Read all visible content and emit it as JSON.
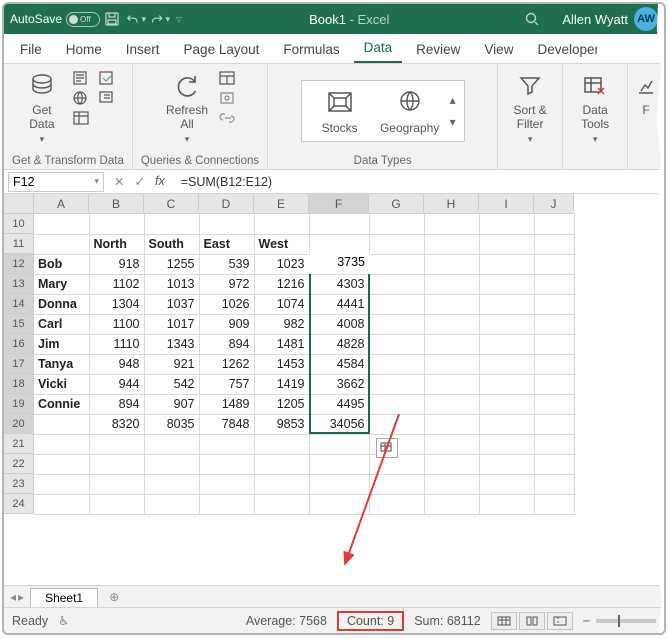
{
  "titlebar": {
    "autosave_label": "AutoSave",
    "autosave_state": "Off",
    "doc": "Book1",
    "app": "Excel",
    "user": "Allen Wyatt",
    "initials": "AW"
  },
  "tabs": [
    "File",
    "Home",
    "Insert",
    "Page Layout",
    "Formulas",
    "Data",
    "Review",
    "View",
    "Developer"
  ],
  "active_tab": "Data",
  "ribbon": {
    "group1_label": "Get & Transform Data",
    "get_data": "Get\nData",
    "group2_label": "Queries & Connections",
    "refresh_all": "Refresh\nAll",
    "group3_label": "Data Types",
    "stocks": "Stocks",
    "geography": "Geography",
    "sort_filter": "Sort &\nFilter",
    "data_tools": "Data\nTools",
    "forecast_initial": "F"
  },
  "namebox": "F12",
  "formula": "=SUM(B12:E12)",
  "columns": [
    "A",
    "B",
    "C",
    "D",
    "E",
    "F",
    "G",
    "H",
    "I",
    "J"
  ],
  "rows": [
    "10",
    "11",
    "12",
    "13",
    "14",
    "15",
    "16",
    "17",
    "18",
    "19",
    "20",
    "21",
    "22",
    "23",
    "24"
  ],
  "headers": {
    "B": "North",
    "C": "South",
    "D": "East",
    "E": "West"
  },
  "data": [
    {
      "name": "Bob",
      "v": [
        918,
        1255,
        539,
        1023
      ],
      "t": 3735
    },
    {
      "name": "Mary",
      "v": [
        1102,
        1013,
        972,
        1216
      ],
      "t": 4303
    },
    {
      "name": "Donna",
      "v": [
        1304,
        1037,
        1026,
        1074
      ],
      "t": 4441
    },
    {
      "name": "Carl",
      "v": [
        1100,
        1017,
        909,
        982
      ],
      "t": 4008
    },
    {
      "name": "Jim",
      "v": [
        1110,
        1343,
        894,
        1481
      ],
      "t": 4828
    },
    {
      "name": "Tanya",
      "v": [
        948,
        921,
        1262,
        1453
      ],
      "t": 4584
    },
    {
      "name": "Vicki",
      "v": [
        944,
        542,
        757,
        1419
      ],
      "t": 3662
    },
    {
      "name": "Connie",
      "v": [
        894,
        907,
        1489,
        1205
      ],
      "t": 4495
    }
  ],
  "totals": {
    "v": [
      8320,
      8035,
      7848,
      9853
    ],
    "t": 34056
  },
  "sheet": "Sheet1",
  "status": {
    "ready": "Ready",
    "average": "Average: 7568",
    "count": "Count: 9",
    "sum": "Sum: 68112"
  }
}
